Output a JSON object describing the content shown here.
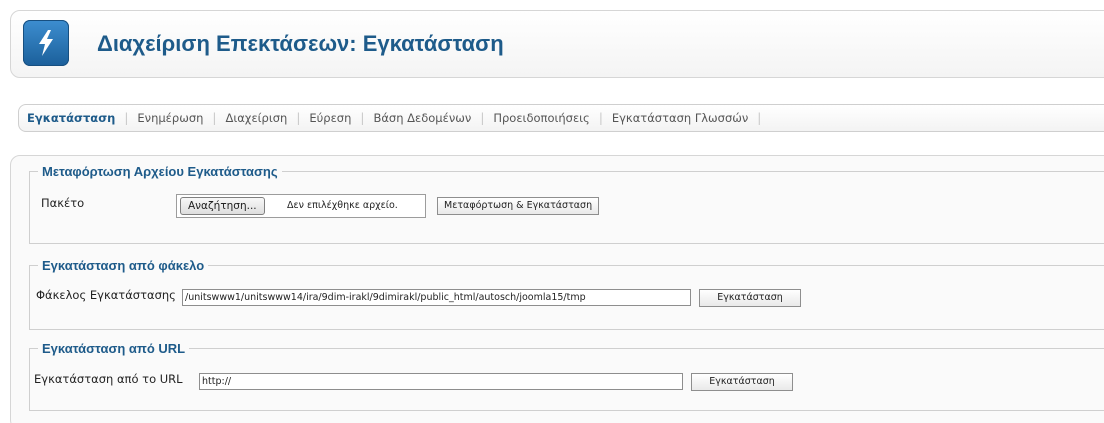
{
  "header": {
    "title": "Διαχείριση Επεκτάσεων: Εγκατάσταση",
    "icon": "lightning-bolt-icon",
    "accent_color": "#1e5b8a",
    "icon_color": "#2a77b8"
  },
  "tabs": [
    {
      "label": "Εγκατάσταση",
      "active": true
    },
    {
      "label": "Ενημέρωση",
      "active": false
    },
    {
      "label": "Διαχείριση",
      "active": false
    },
    {
      "label": "Εύρεση",
      "active": false
    },
    {
      "label": "Βάση Δεδομένων",
      "active": false
    },
    {
      "label": "Προειδοποιήσεις",
      "active": false
    },
    {
      "label": "Εγκατάσταση Γλωσσών",
      "active": false
    }
  ],
  "upload_section": {
    "legend": "Μεταφόρτωση Αρχείου Εγκατάστασης",
    "package_label": "Πακέτο",
    "browse_button": "Αναζήτηση...",
    "file_status": "Δεν επιλέχθηκε αρχείο.",
    "submit_button": "Μεταφόρτωση & Εγκατάσταση"
  },
  "folder_section": {
    "legend": "Εγκατάσταση από φάκελο",
    "field_label": "Φάκελος Εγκατάστασης",
    "field_value": "/unitswww1/unitswww14/ira/9dim-irakl/9dimirakl/public_html/autosch/joomla15/tmp",
    "submit_button": "Εγκατάσταση"
  },
  "url_section": {
    "legend": "Εγκατάσταση από URL",
    "field_label": "Εγκατάσταση από το URL",
    "field_value": "http://",
    "submit_button": "Εγκατάσταση"
  }
}
